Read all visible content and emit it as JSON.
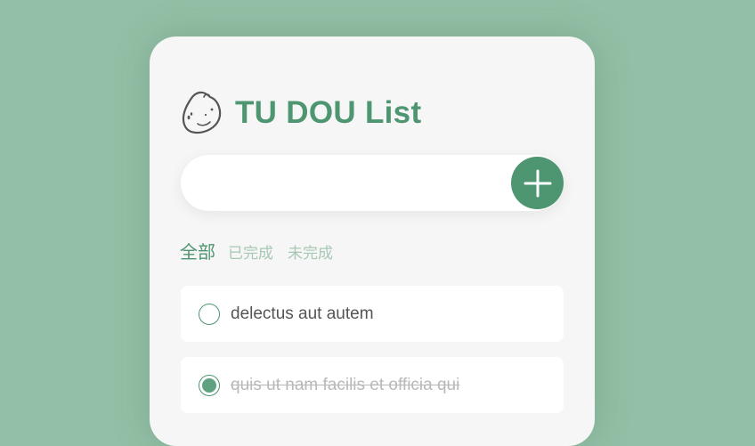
{
  "app": {
    "title": "TU DOU List",
    "logo_icon": "potato-icon",
    "accent_color": "#4e9571",
    "background_color": "#93bfa6"
  },
  "add_bar": {
    "input_value": "",
    "button_icon": "plus-icon"
  },
  "filters": [
    {
      "label": "全部",
      "active": true
    },
    {
      "label": "已完成",
      "active": false
    },
    {
      "label": "未完成",
      "active": false
    }
  ],
  "todos": [
    {
      "text": "delectus aut autem",
      "completed": false
    },
    {
      "text": "quis ut nam facilis et officia qui",
      "completed": true
    }
  ]
}
